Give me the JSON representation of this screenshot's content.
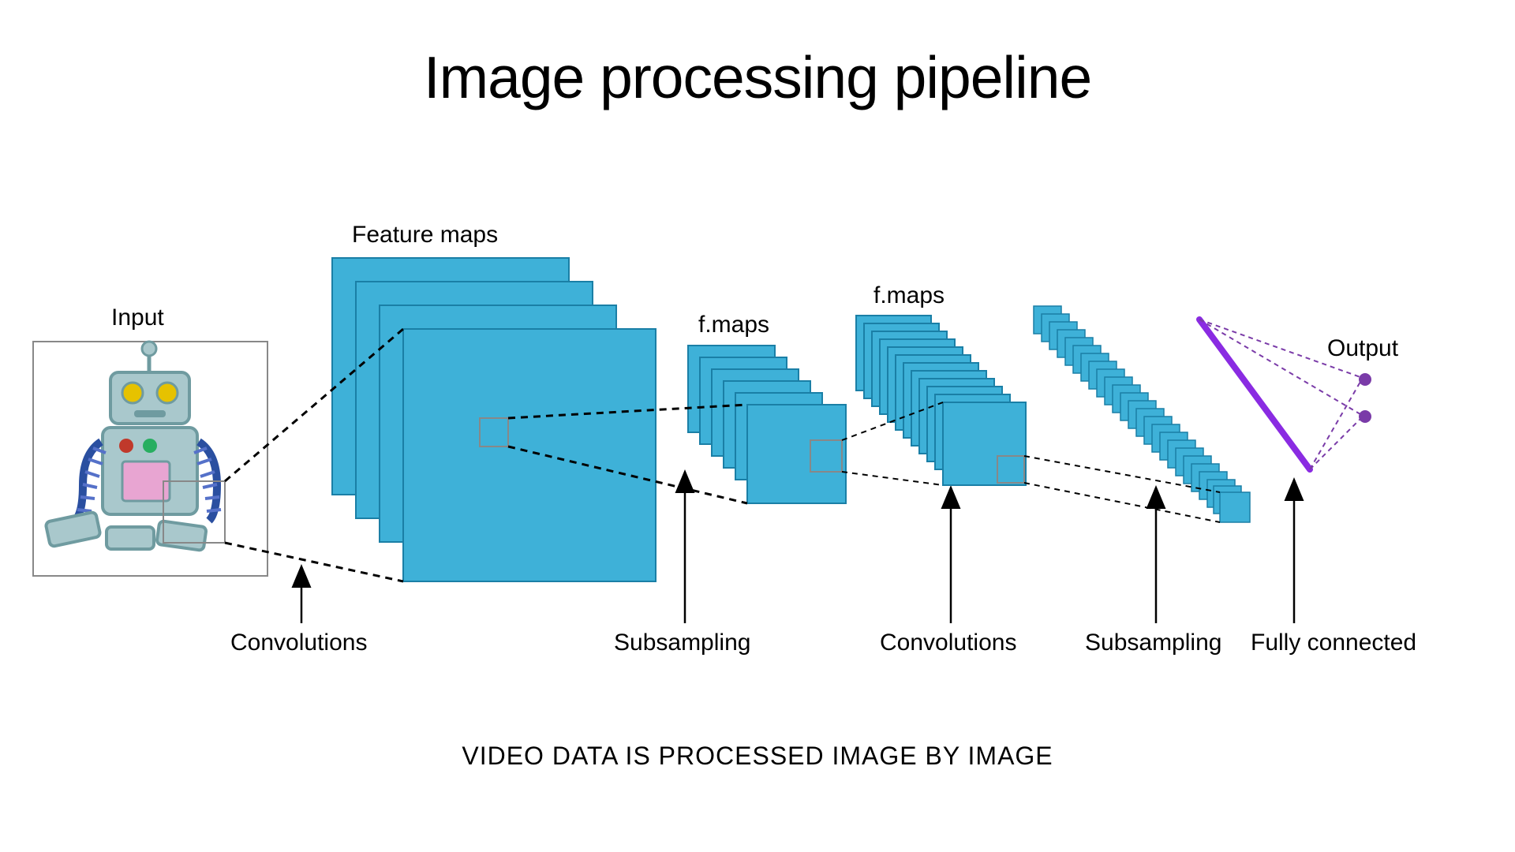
{
  "title": "Image processing pipeline",
  "caption": "VIDEO DATA IS PROCESSED IMAGE BY IMAGE",
  "labels": {
    "input": "Input",
    "feature_maps": "Feature maps",
    "fmaps1": "f.maps",
    "fmaps2": "f.maps",
    "output": "Output",
    "convolutions1": "Convolutions",
    "subsampling1": "Subsampling",
    "convolutions2": "Convolutions",
    "subsampling2": "Subsampling",
    "fully_connected": "Fully connected"
  },
  "colors": {
    "tile_fill": "#3eb1d8",
    "tile_stroke": "#1a7fa6",
    "fc_line": "#8a2be2",
    "output_dot": "#7a3ba8",
    "robot_body": "#a9c8cc",
    "robot_body_dark": "#6f9ba0",
    "robot_eye": "#e6c200",
    "robot_btn_r": "#c0392b",
    "robot_btn_g": "#27ae60",
    "robot_belly": "#e8a5d2"
  },
  "pipeline": {
    "stages": [
      {
        "name": "input"
      },
      {
        "name": "feature_maps",
        "count": 4
      },
      {
        "name": "fmaps_small_1",
        "count": 6
      },
      {
        "name": "fmaps_small_2",
        "count": 12
      },
      {
        "name": "fmaps_tiny",
        "count": 25
      },
      {
        "name": "fully_connected"
      },
      {
        "name": "output_nodes",
        "count": 2
      }
    ],
    "operations": [
      "Convolutions",
      "Subsampling",
      "Convolutions",
      "Subsampling",
      "Fully connected"
    ]
  }
}
